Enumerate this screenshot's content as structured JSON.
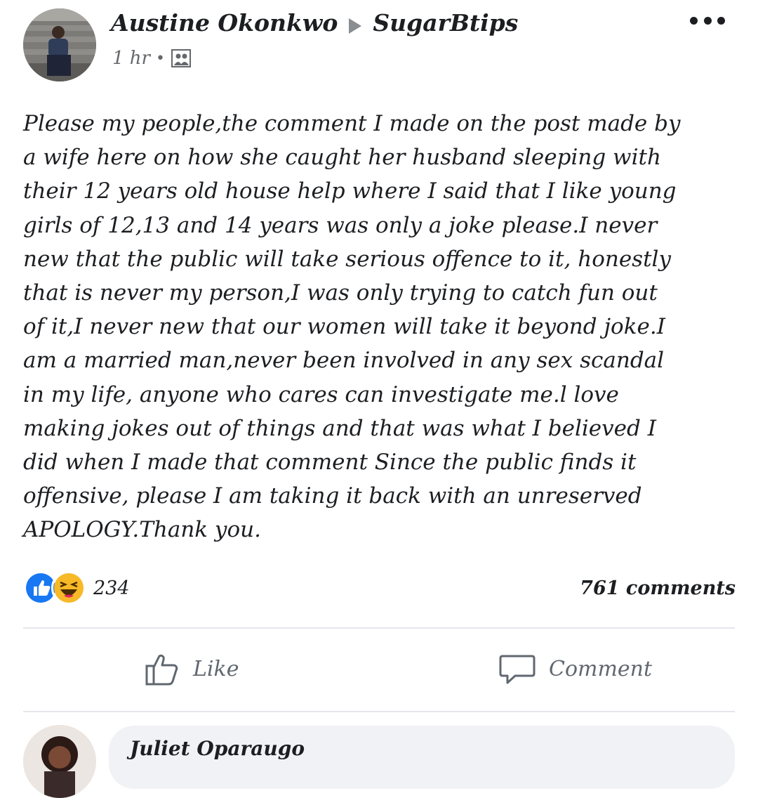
{
  "post": {
    "author": "Austine Okonkwo",
    "group": "SugarBtips",
    "time": "1 hr",
    "separator": "•",
    "audience_icon": "group-icon",
    "text": "Please my people,the comment I made on the post made by\na wife here on how she caught her husband sleeping with\ntheir 12 years old house help where I said that I like young\ngirls of 12,13 and 14 years was only a joke please.I never\nnew that the public will take serious offence to it, honestly\nthat is never my person,I was only trying to catch fun out\nof it,I never new that our women will take it beyond joke.I\nam a married man,never been involved in any sex scandal\nin my life, anyone who cares can investigate me.l love\nmaking jokes out of things and that was what I believed I\ndid when I made that comment Since the public finds it\noffensive, please I am taking it back with an unreserved\nAPOLOGY.Thank you."
  },
  "reactions": {
    "icons": [
      "like-icon",
      "haha-icon"
    ],
    "count": "234",
    "comments": "761 comments"
  },
  "actions": {
    "like_label": "Like",
    "comment_label": "Comment"
  },
  "comment_preview": {
    "name": "Juliet Oparaugo"
  },
  "colors": {
    "like_blue": "#1877f2",
    "haha_yellow": "#f7b928",
    "secondary_text": "#65676b",
    "bubble_bg": "#f0f2f5"
  }
}
